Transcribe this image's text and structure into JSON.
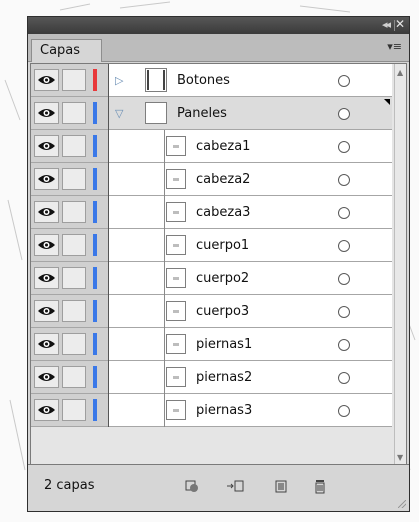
{
  "panel": {
    "tab_label": "Capas",
    "collapse_glyph": "◂◂",
    "close_glyph": "✕",
    "menu_glyph": "▾≡"
  },
  "colors": {
    "top_layer_color": "#e8383a",
    "sub_layer_color": "#3a78e8"
  },
  "layers": [
    {
      "name": "Botones",
      "level": 0,
      "expanded": false,
      "selected": false,
      "color": "#e8383a",
      "icon": "triangle-right-icon"
    },
    {
      "name": "Paneles",
      "level": 0,
      "expanded": true,
      "selected": true,
      "color": "#3a78e8",
      "icon": "triangle-down-icon"
    },
    {
      "name": "cabeza1",
      "level": 1,
      "color": "#3a78e8"
    },
    {
      "name": "cabeza2",
      "level": 1,
      "color": "#3a78e8"
    },
    {
      "name": "cabeza3",
      "level": 1,
      "color": "#3a78e8"
    },
    {
      "name": "cuerpo1",
      "level": 1,
      "color": "#3a78e8"
    },
    {
      "name": "cuerpo2",
      "level": 1,
      "color": "#3a78e8"
    },
    {
      "name": "cuerpo3",
      "level": 1,
      "color": "#3a78e8"
    },
    {
      "name": "piernas1",
      "level": 1,
      "color": "#3a78e8"
    },
    {
      "name": "piernas2",
      "level": 1,
      "color": "#3a78e8"
    },
    {
      "name": "piernas3",
      "level": 1,
      "color": "#3a78e8"
    }
  ],
  "footer": {
    "layer_count": "2 capas",
    "icons": [
      "make-clipping-mask-icon",
      "create-sublayer-icon",
      "create-new-layer-icon",
      "delete-layer-icon"
    ]
  }
}
